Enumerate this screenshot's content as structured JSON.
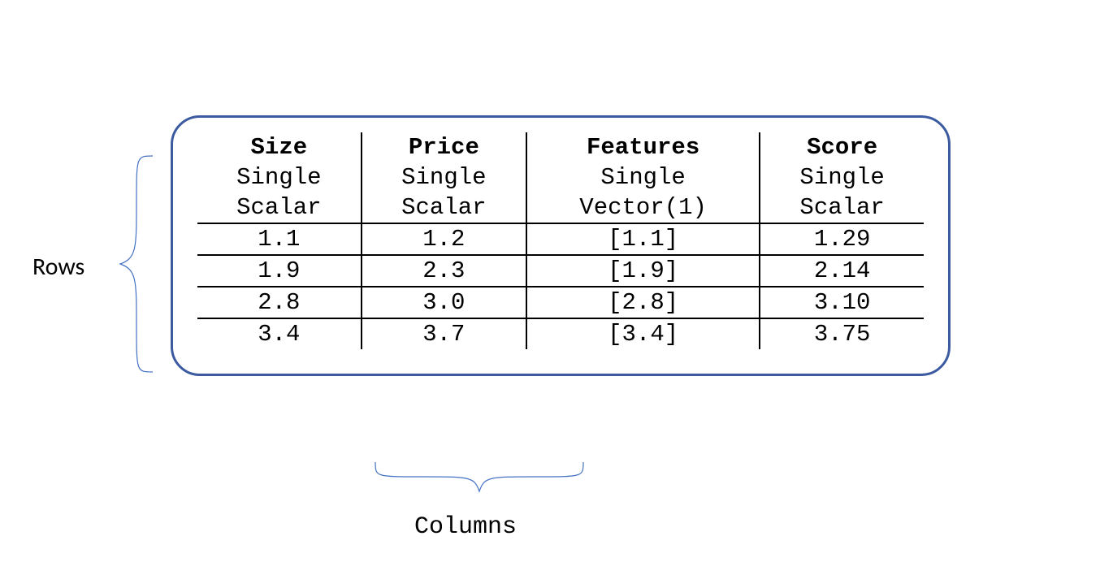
{
  "labels": {
    "rows": "Rows",
    "columns": "Columns"
  },
  "columns": [
    {
      "name": "Size",
      "role": "Single",
      "type": "Scalar"
    },
    {
      "name": "Price",
      "role": "Single",
      "type": "Scalar"
    },
    {
      "name": "Features",
      "role": "Single",
      "type": "Vector(1)"
    },
    {
      "name": "Score",
      "role": "Single",
      "type": "Scalar"
    }
  ],
  "rows": [
    {
      "size": "1.1",
      "price": "1.2",
      "features": "[1.1]",
      "score": "1.29"
    },
    {
      "size": "1.9",
      "price": "2.3",
      "features": "[1.9]",
      "score": "2.14"
    },
    {
      "size": "2.8",
      "price": "3.0",
      "features": "[2.8]",
      "score": "3.10"
    },
    {
      "size": "3.4",
      "price": "3.7",
      "features": "[3.4]",
      "score": "3.75"
    }
  ]
}
